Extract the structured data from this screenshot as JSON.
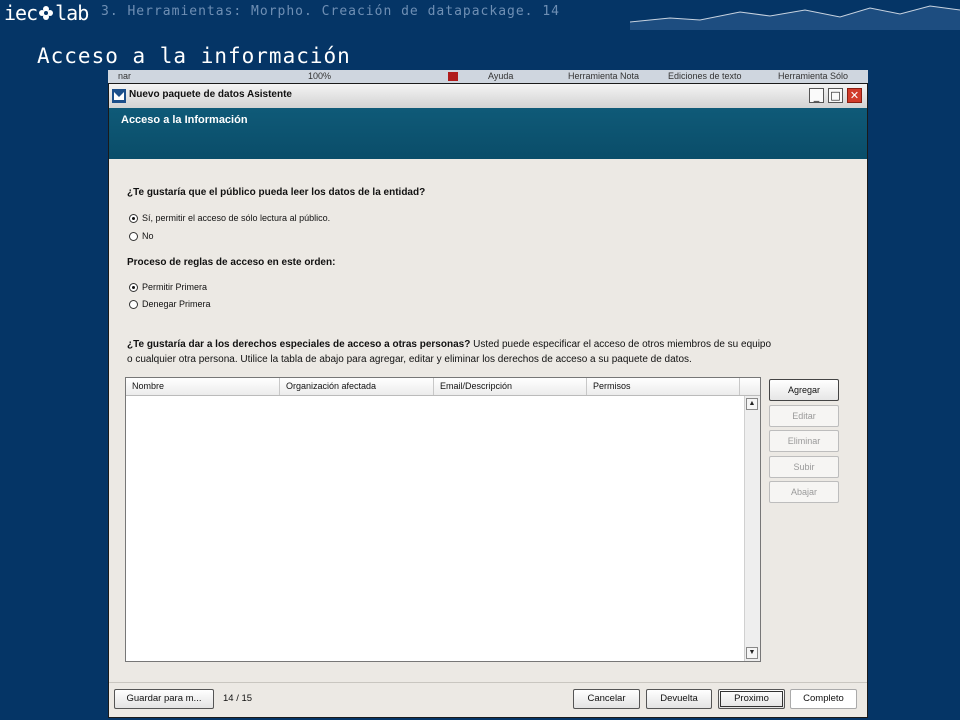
{
  "slide": {
    "logo_left": "iec",
    "logo_right": "lab",
    "breadcrumb": "3. Herramientas: Morpho. Creación de datapackage. 14",
    "title": "Acceso a la información"
  },
  "background_app": {
    "left_fragment": "nar",
    "zoom": "100%",
    "help": "Ayuda",
    "tool_note": "Herramienta Nota",
    "text_editions": "Ediciones de texto",
    "tool_only": "Herramienta Sólo"
  },
  "window": {
    "title": "Nuevo paquete de datos Asistente",
    "banner_title": "Acceso a la Información",
    "controls": {
      "minimize": "_",
      "maximize": "□",
      "close": "✕"
    }
  },
  "public_read": {
    "question": "¿Te gustaría que el público pueda leer los datos de la entidad?",
    "options": [
      {
        "label": "Sí, permitir el acceso de sólo lectura al público.",
        "selected": true
      },
      {
        "label": "No",
        "selected": false
      }
    ]
  },
  "rule_order": {
    "question": "Proceso de reglas de acceso en este orden:",
    "options": [
      {
        "label": "Permitir Primera",
        "selected": true
      },
      {
        "label": "Denegar Primera",
        "selected": false
      }
    ]
  },
  "special_rights": {
    "question": "¿Te gustaría dar a los derechos especiales de acceso a otras personas?",
    "description_line1": " Usted puede especificar el acceso de otros miembros de su equipo",
    "description_line2": "o cualquier otra persona. Utilice la tabla de abajo para agregar, editar y eliminar los derechos de acceso a su paquete de datos."
  },
  "table": {
    "columns": [
      "Nombre",
      "Organización afectada",
      "Email/Descripción",
      "Permisos"
    ],
    "rows": []
  },
  "side_buttons": {
    "add": "Agregar",
    "edit": "Editar",
    "delete": "Eliminar",
    "up": "Subir",
    "down": "Abajar"
  },
  "footer": {
    "save": "Guardar para m...",
    "page": "14 / 15",
    "cancel": "Cancelar",
    "back": "Devuelta",
    "next": "Proximo",
    "finish": "Completo"
  },
  "colors": {
    "slide_bg": "#053566",
    "banner": "#0a4d69",
    "dialog_bg": "#ece9e4",
    "close_red": "#d13b2a"
  }
}
